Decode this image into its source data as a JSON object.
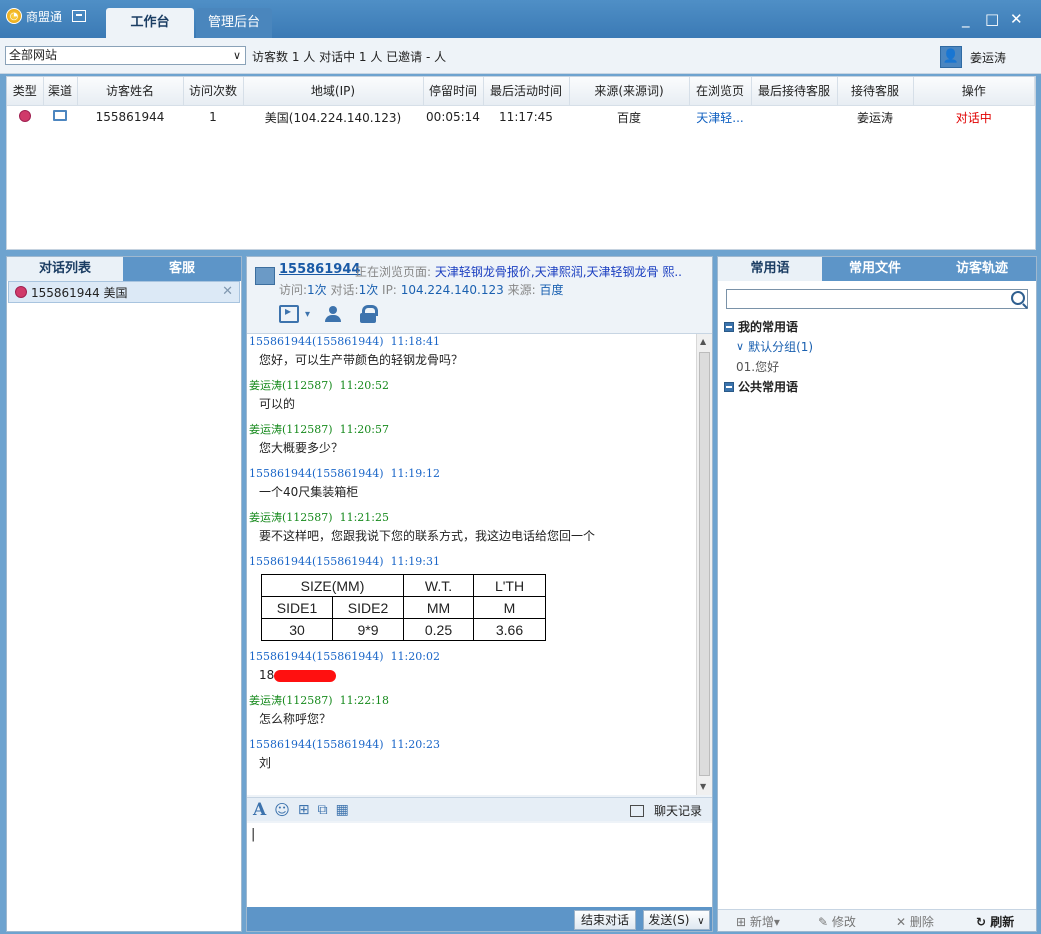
{
  "app": {
    "name": "商盟通",
    "tabs": [
      "工作台",
      "管理后台"
    ],
    "window_controls": [
      "_",
      "□",
      "✕"
    ]
  },
  "toolbar": {
    "site_select": "全部网站",
    "stats": "访客数 1 人   对话中 1 人   已邀请 - 人",
    "user_name": "姜运涛"
  },
  "visitor_table": {
    "columns": [
      "类型",
      "渠道",
      "访客姓名",
      "访问次数",
      "地域(IP)",
      "停留时间",
      "最后活动时间",
      "来源(来源词)",
      "在浏览页",
      "最后接待客服",
      "接待客服",
      "操作"
    ],
    "rows": [
      {
        "name": "155861944",
        "visits": "1",
        "region": "美国(104.224.140.123)",
        "stay": "00:05:14",
        "last_active": "11:17:45",
        "source": "百度",
        "page": "天津轻...",
        "last_agent": "",
        "agent": "姜运涛",
        "status": "对话中"
      }
    ]
  },
  "left_panel": {
    "tabs": [
      "对话列表",
      "客服"
    ],
    "conversations": [
      {
        "label": "155861944 美国"
      }
    ]
  },
  "chat": {
    "visitor_id": "155861944",
    "browse_label": "正在浏览页面:",
    "browse_pages": "天津轻钢龙骨报价,天津熙润,天津轻钢龙骨 熙..",
    "info": {
      "visits_label": "访问:",
      "visits": "1次",
      "talks_label": "对话:",
      "talks": "1次",
      "ip_label": "IP:",
      "ip": "104.224.140.123",
      "source_label": "来源:",
      "source": "百度"
    },
    "messages": [
      {
        "sender": "155861944(155861944)",
        "time": "11:18:41",
        "text": "您好，可以生产带颜色的轻钢龙骨吗？"
      },
      {
        "sender": "姜运涛(112587)",
        "time": "11:20:52",
        "text": "可以的"
      },
      {
        "sender": "姜运涛(112587)",
        "time": "11:20:57",
        "text": "您大概要多少？"
      },
      {
        "sender": "155861944(155861944)",
        "time": "11:19:12",
        "text": "一个40尺集装箱柜"
      },
      {
        "sender": "姜运涛(112587)",
        "time": "11:21:25",
        "text": "要不这样吧，您跟我说下您的联系方式，我这边电话给您回一个"
      },
      {
        "sender": "155861944(155861944)",
        "time": "11:19:31",
        "text": ""
      },
      {
        "sender": "155861944(155861944)",
        "time": "11:20:02",
        "text": "18"
      },
      {
        "sender": "姜运涛(112587)",
        "time": "11:22:18",
        "text": "怎么称呼您？"
      },
      {
        "sender": "155861944(155861944)",
        "time": "11:20:23",
        "text": "刘"
      }
    ],
    "spec_table": {
      "header": [
        "SIZE(MM)",
        "W.T.",
        "L'TH"
      ],
      "subheader": [
        "SIDE1",
        "SIDE2",
        "MM",
        "M"
      ],
      "row": [
        "30",
        "9*9",
        "0.25",
        "3.66"
      ]
    },
    "history_label": "聊天记录",
    "input_value": "|",
    "end_chat": "结束对话",
    "send": "发送(S)"
  },
  "right_panel": {
    "tabs": [
      "常用语",
      "常用文件",
      "访客轨迹"
    ],
    "search_placeholder": "",
    "tree": {
      "my_phrases": "我的常用语",
      "default_group": "默认分组(1)",
      "item": "01.您好",
      "public_phrases": "公共常用语"
    },
    "footer": {
      "add": "新增",
      "edit": "修改",
      "delete": "删除",
      "refresh": "刷新"
    }
  },
  "colors": {
    "accent": "#3b7ab5",
    "visitor_msg": "#1a66c8",
    "agent_msg": "#178a1d",
    "status_active": "#e00000"
  }
}
